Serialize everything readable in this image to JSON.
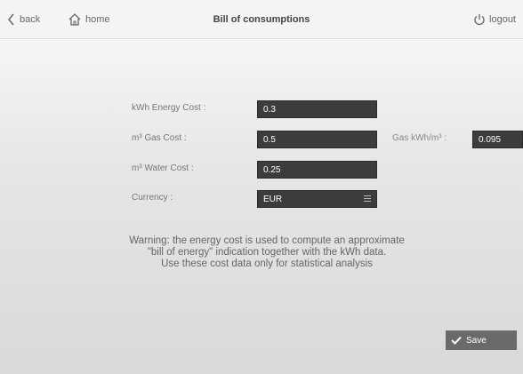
{
  "header": {
    "back_label": "back",
    "home_label": "home",
    "title": "Bill of consumptions",
    "logout_label": "logout"
  },
  "form": {
    "energy_cost": {
      "label": "kWh Energy Cost :",
      "value": "0.3"
    },
    "gas_cost": {
      "label": "m³ Gas Cost :",
      "value": "0.5"
    },
    "gas_kwh": {
      "label": "Gas kWh/m³ :",
      "value": "0.095"
    },
    "water_cost": {
      "label": "m³ Water Cost :",
      "value": "0.25"
    },
    "currency": {
      "label": "Currency :",
      "value": "EUR"
    }
  },
  "warning": {
    "line1": "Warning: the energy cost is used to compute an approximate",
    "line2": "\"bill of energy\" indication together with the kWh data.",
    "line3": "Use these cost data only for statistical analysis"
  },
  "save_label": "Save",
  "icons": {
    "back": "chevron-left-icon",
    "home": "home-icon",
    "logout": "power-icon",
    "save": "checkmark-icon",
    "select": "menu-lines-icon"
  },
  "colors": {
    "field_bg": "#3c3c3c",
    "save_bg": "#6a6a6a"
  }
}
